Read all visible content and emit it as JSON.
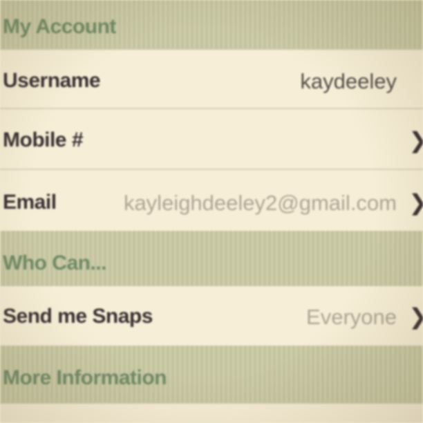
{
  "sections": {
    "my_account": {
      "title": "My Account",
      "username": {
        "label": "Username",
        "value": "kaydeeley"
      },
      "mobile": {
        "label": "Mobile #"
      },
      "email": {
        "label": "Email",
        "value": "kayleighdeeley2@gmail.com"
      }
    },
    "who_can": {
      "title": "Who Can...",
      "send_me_snaps": {
        "label": "Send me Snaps",
        "value": "Everyone"
      }
    },
    "more_information": {
      "title": "More Information"
    }
  },
  "icons": {
    "disclosure": "chevron-right-icon"
  },
  "colors": {
    "section_header_bg": "#c9c9a3",
    "section_header_text": "#6f8a66",
    "row_bg": "#f6eed6",
    "label_text": "#3a3034",
    "value_text": "#544c4b",
    "muted_value_text": "#aea596"
  }
}
